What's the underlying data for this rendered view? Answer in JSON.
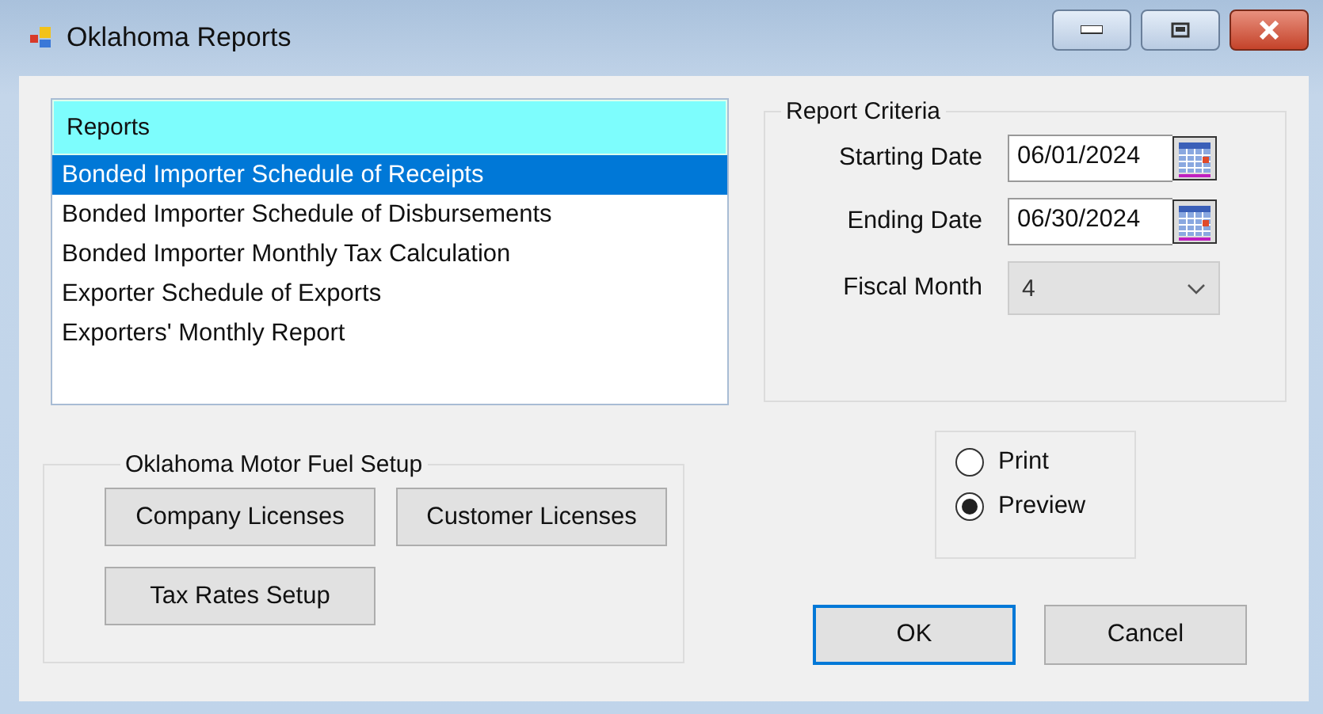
{
  "window": {
    "title": "Oklahoma Reports"
  },
  "reports": {
    "header": "Reports",
    "items": [
      {
        "label": "Bonded Importer Schedule of Receipts",
        "selected": true
      },
      {
        "label": "Bonded Importer Schedule of Disbursements",
        "selected": false
      },
      {
        "label": "Bonded Importer Monthly Tax Calculation",
        "selected": false
      },
      {
        "label": "Exporter Schedule of Exports",
        "selected": false
      },
      {
        "label": "Exporters' Monthly Report",
        "selected": false
      }
    ]
  },
  "criteria": {
    "title": "Report Criteria",
    "starting_date": {
      "label": "Starting Date",
      "value": "06/01/2024"
    },
    "ending_date": {
      "label": "Ending Date",
      "value": "06/30/2024"
    },
    "fiscal_month": {
      "label": "Fiscal Month",
      "value": "4",
      "disabled": true
    }
  },
  "setup": {
    "title": "Oklahoma Motor Fuel Setup",
    "buttons": [
      "Company Licenses",
      "Customer Licenses",
      "Tax Rates Setup"
    ]
  },
  "output": [
    {
      "label": "Print",
      "selected": false
    },
    {
      "label": "Preview",
      "selected": true
    }
  ],
  "buttons": [
    {
      "label": "OK",
      "default": true
    },
    {
      "label": "Cancel",
      "default": false
    }
  ]
}
